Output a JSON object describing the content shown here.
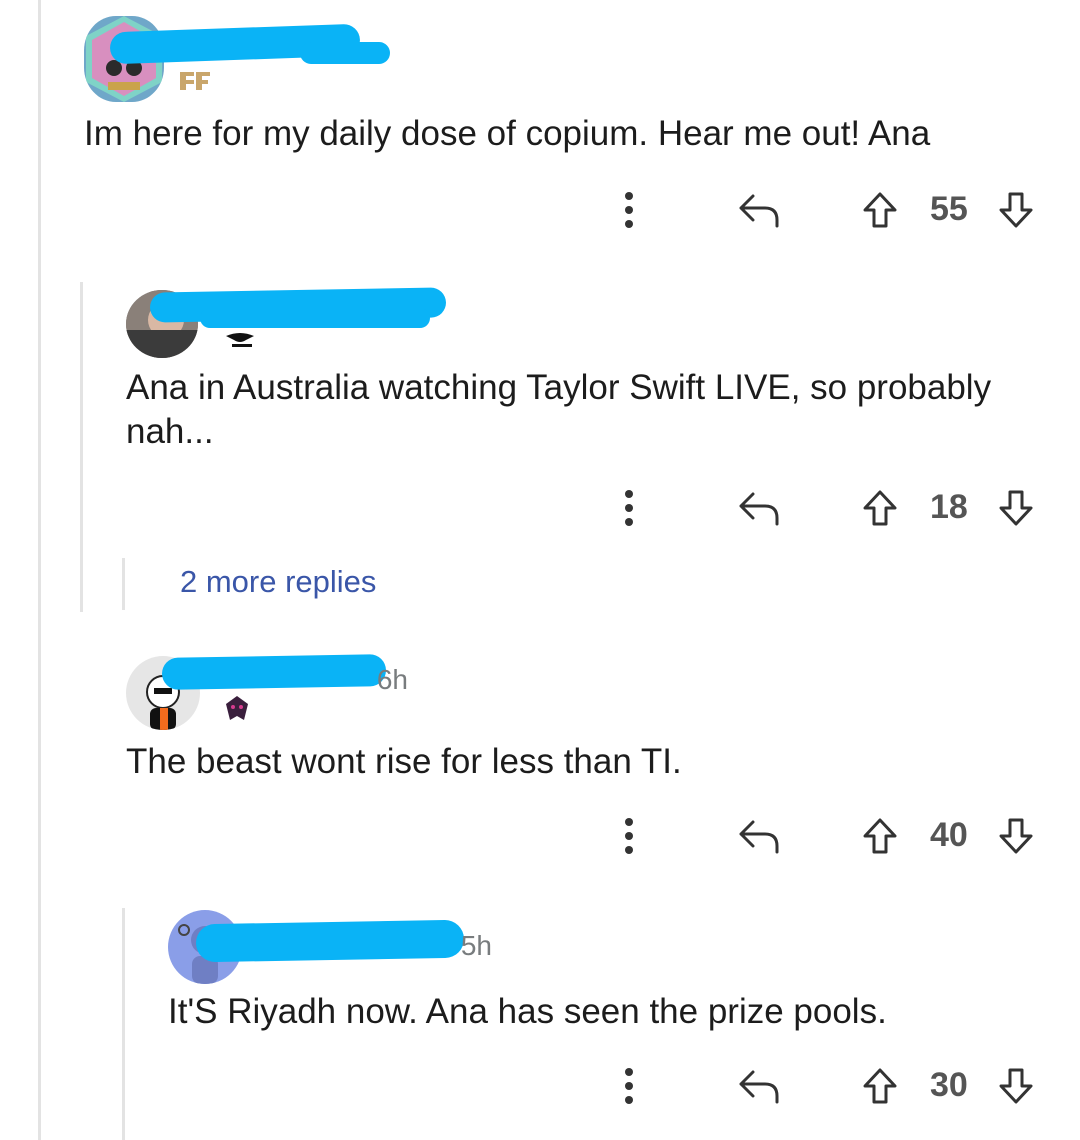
{
  "comments": [
    {
      "text": "Im here for my daily dose of copium. Hear me out! Ana",
      "score": "55"
    },
    {
      "text": "Ana in Australia watching Taylor Swift LIVE, so probably nah...",
      "score": "18"
    },
    {
      "text": "The beast wont rise for less than TI.",
      "score": "40",
      "time": "6h"
    },
    {
      "text": "It'S Riyadh now. Ana has seen the prize pools.",
      "score": "30",
      "time": "5h"
    }
  ],
  "more_replies": "2 more replies",
  "icons": [
    "more-vertical-icon",
    "reply-icon",
    "upvote-icon",
    "downvote-icon"
  ],
  "colors": {
    "redaction": "#0ab3f6",
    "link": "#3a56a8",
    "meta": "#787c7e"
  }
}
